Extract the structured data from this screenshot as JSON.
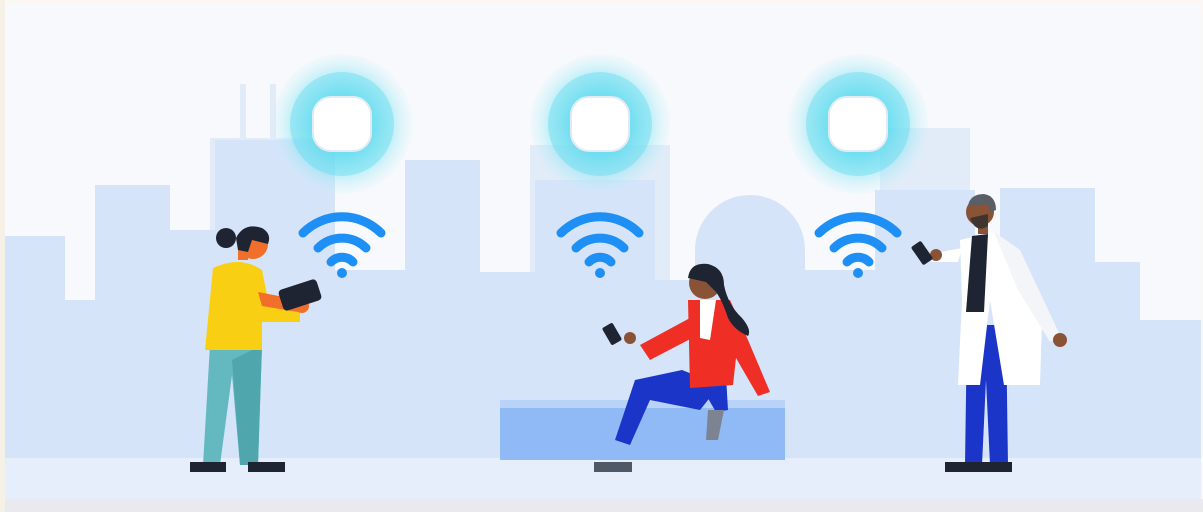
{
  "illustration": {
    "access_points": [
      {
        "id": "ap-left",
        "signal": "wifi-icon"
      },
      {
        "id": "ap-center",
        "signal": "wifi-icon"
      },
      {
        "id": "ap-right",
        "signal": "wifi-icon"
      }
    ],
    "people": [
      {
        "id": "person-tablet",
        "device": "tablet"
      },
      {
        "id": "person-seated",
        "device": "phone"
      },
      {
        "id": "person-labcoat",
        "device": "phone"
      }
    ],
    "colors": {
      "background": "#fbf8f1",
      "skyline": "#d6e4f9",
      "skyline_back": "#dfe9f8",
      "ground": "#e8effa",
      "floor_strip": "#e9e9ee",
      "wifi": "#1e8ff5",
      "ap_glow": "#4fd7ee",
      "bench": "#8fbaf5"
    }
  }
}
